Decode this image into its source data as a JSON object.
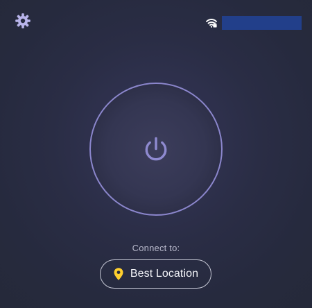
{
  "header": {
    "settings_icon": "gear-icon",
    "network_icon": "wifi-lock-icon",
    "network_name": ""
  },
  "main": {
    "power_icon": "power-icon",
    "connect_label": "Connect to:",
    "location_button": {
      "icon": "location-pin-icon",
      "label": "Best Location"
    }
  },
  "colors": {
    "background": "#262a3e",
    "ring": "#8b86cc",
    "accent_pin": "#ffcf2e",
    "network_highlight": "#223f8a"
  }
}
